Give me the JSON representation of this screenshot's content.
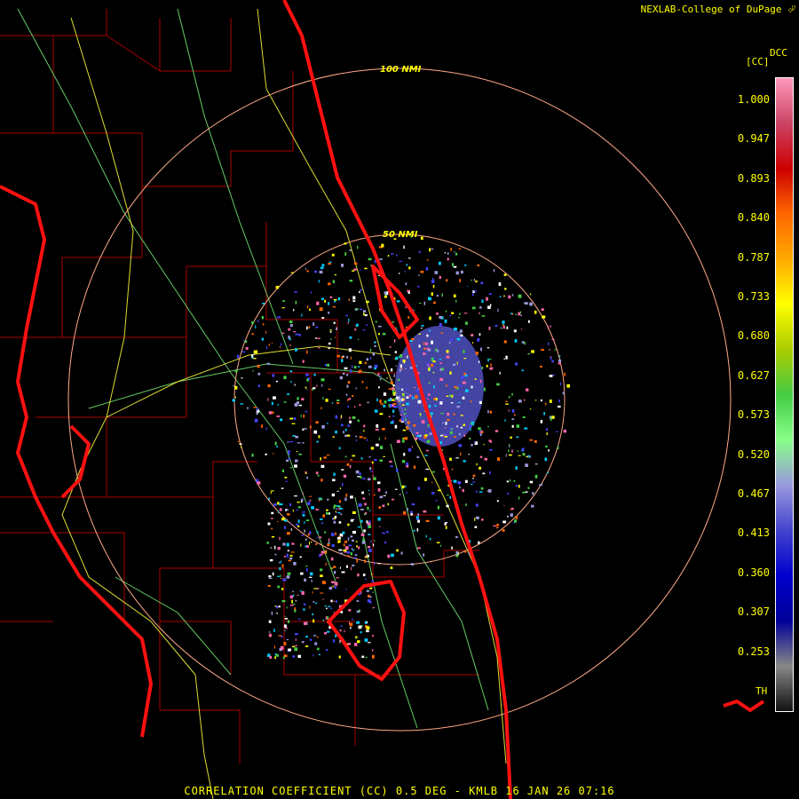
{
  "header": {
    "credit": "NEXLAB-College of DuPage",
    "credit_icon": "cod-logo-icon"
  },
  "legend": {
    "product": "DCC",
    "unit": "[CC]",
    "threshold_label": "TH",
    "ticks": [
      "1.000",
      "0.947",
      "0.893",
      "0.840",
      "0.787",
      "0.733",
      "0.680",
      "0.627",
      "0.573",
      "0.520",
      "0.467",
      "0.413",
      "0.360",
      "0.307",
      "0.253"
    ],
    "colors": [
      "#ff99bb",
      "#cc4466",
      "#cc0000",
      "#ff6600",
      "#ffaa00",
      "#ffff00",
      "#aacc00",
      "#44cc44",
      "#88ff88",
      "#9999dd",
      "#4444cc",
      "#0000cc",
      "#000099",
      "#888888",
      "#111111"
    ]
  },
  "map": {
    "ring_labels": [
      "100 NMI",
      "50 NMI"
    ]
  },
  "footer": {
    "caption": "CORRELATION COEFFICIENT (CC) 0.5 DEG - KMLB 16 JAN 26 07:16"
  }
}
